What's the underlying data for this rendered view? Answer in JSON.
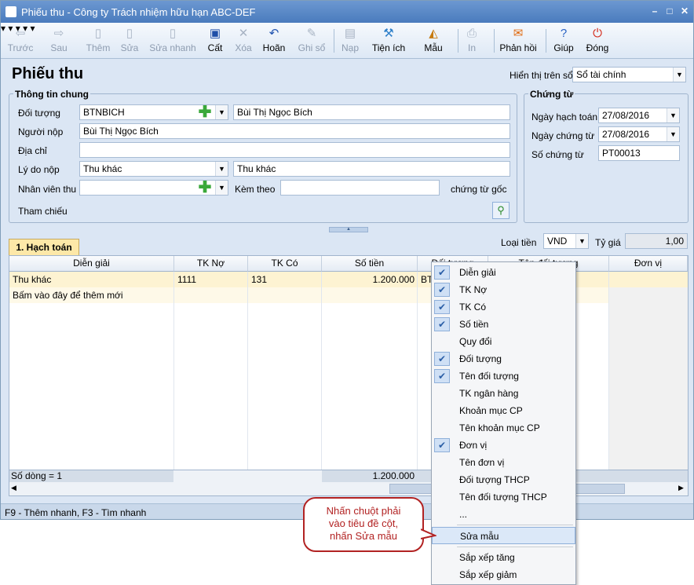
{
  "window": {
    "title": "Phiếu thu - Công ty Trách nhiệm hữu hạn ABC-DEF"
  },
  "toolbar": {
    "prev": "Trước",
    "next": "Sau",
    "add": "Thêm",
    "edit": "Sửa",
    "quick_edit": "Sửa nhanh",
    "save": "Cất",
    "delete": "Xóa",
    "undo": "Hoãn",
    "post": "Ghi sổ",
    "load": "Nạp",
    "utilities": "Tiện ích",
    "template": "Mẫu",
    "print": "In",
    "feedback": "Phản hồi",
    "help": "Giúp",
    "close": "Đóng"
  },
  "page": {
    "title": "Phiếu thu",
    "view_label": "Hiển thị trên sổ",
    "view_value": "Sổ tài chính"
  },
  "general": {
    "title": "Thông tin chung",
    "object_label": "Đối tượng",
    "object_code": "BTNBICH",
    "object_name": "Bùi Thị Ngọc Bích",
    "payer_label": "Người nộp",
    "payer": "Bùi Thị Ngọc Bích",
    "address_label": "Địa chỉ",
    "address": "",
    "reason_label": "Lý do nộp",
    "reason_code": "Thu khác",
    "reason_text": "Thu khác",
    "staff_label": "Nhân viên thu",
    "staff": "",
    "attach_label": "Kèm theo",
    "attach": "",
    "attach_suffix": "chứng từ gốc",
    "reference_label": "Tham chiếu"
  },
  "voucher": {
    "title": "Chứng từ",
    "account_date_label": "Ngày hạch toán",
    "account_date": "27/08/2016",
    "voucher_date_label": "Ngày chứng từ",
    "voucher_date": "27/08/2016",
    "number_label": "Số chứng từ",
    "number": "PT00013"
  },
  "accounting": {
    "tab": "1. Hạch toán",
    "currency_label": "Loại tiền",
    "currency": "VND",
    "rate_label": "Tỷ giá",
    "rate": "1,00"
  },
  "grid": {
    "columns": [
      "Diễn giải",
      "TK Nợ",
      "TK Có",
      "Số tiền",
      "Đối tượng",
      "Tên đối tượng",
      "Đơn vị"
    ],
    "rows": [
      {
        "desc": "Thu khác",
        "debit": "1111",
        "credit": "131",
        "amount": "1.200.000",
        "object": "BT"
      }
    ],
    "new_row": "Bấm vào đây để thêm mới",
    "footer_count": "Số dòng = 1",
    "footer_total": "1.200.000"
  },
  "status": {
    "hint": "F9 - Thêm nhanh, F3 - Tìm nhanh"
  },
  "menu": {
    "items": [
      {
        "label": "Diễn giải",
        "checked": true
      },
      {
        "label": "TK Nợ",
        "checked": true
      },
      {
        "label": "TK Có",
        "checked": true
      },
      {
        "label": "Số tiền",
        "checked": true
      },
      {
        "label": "Quy đổi",
        "checked": false
      },
      {
        "label": "Đối tượng",
        "checked": true
      },
      {
        "label": "Tên đối tượng",
        "checked": true
      },
      {
        "label": "TK ngân hàng",
        "checked": false
      },
      {
        "label": "Khoản mục CP",
        "checked": false
      },
      {
        "label": "Tên khoản mục CP",
        "checked": false
      },
      {
        "label": "Đơn vị",
        "checked": true
      },
      {
        "label": "Tên đơn vị",
        "checked": false
      },
      {
        "label": "Đối tượng THCP",
        "checked": false
      },
      {
        "label": "Tên đối tượng THCP",
        "checked": false
      },
      {
        "label": "...",
        "checked": false
      }
    ],
    "edit_template": "Sửa mẫu",
    "sort_asc": "Sắp xếp tăng",
    "sort_desc": "Sắp xếp giảm"
  },
  "callout": {
    "line1": "Nhấn chuột phải",
    "line2": "vào tiêu đề cột,",
    "line3": "nhấn Sửa mẫu"
  }
}
